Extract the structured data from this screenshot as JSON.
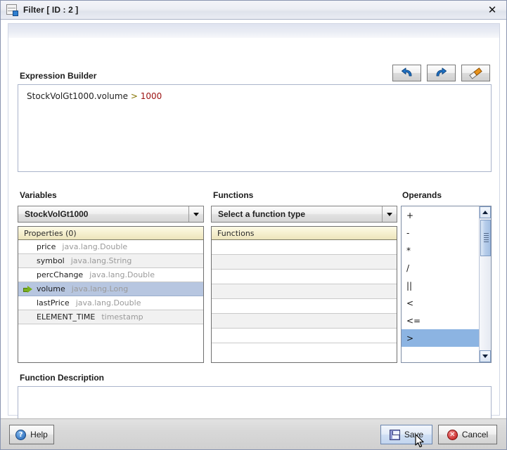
{
  "window": {
    "title": "Filter [ ID : 2 ]",
    "icon": "filter-table-icon",
    "close_label": "✕"
  },
  "expression_builder": {
    "label": "Expression Builder",
    "tools": [
      {
        "name": "undo-button",
        "icon": "undo-icon",
        "title": "Undo"
      },
      {
        "name": "redo-button",
        "icon": "redo-icon",
        "title": "Redo"
      },
      {
        "name": "clear-button",
        "icon": "eraser-icon",
        "title": "Clear"
      }
    ],
    "expression": {
      "operand": "StockVolGt1000.volume",
      "operator": ">",
      "value": "1000"
    }
  },
  "variables": {
    "label": "Variables",
    "selected": "StockVolGt1000",
    "table_header": "Properties (0)",
    "rows": [
      {
        "name": "price",
        "type": "java.lang.Double",
        "selected": false
      },
      {
        "name": "symbol",
        "type": "java.lang.String",
        "selected": false
      },
      {
        "name": "percChange",
        "type": "java.lang.Double",
        "selected": false
      },
      {
        "name": "volume",
        "type": "java.lang.Long",
        "selected": true
      },
      {
        "name": "lastPrice",
        "type": "java.lang.Double",
        "selected": false
      },
      {
        "name": "ELEMENT_TIME",
        "type": "timestamp",
        "selected": false
      }
    ]
  },
  "functions": {
    "label": "Functions",
    "selected": "Select a function type",
    "table_header": "Functions",
    "rows": [
      "",
      "",
      "",
      "",
      "",
      ""
    ]
  },
  "operands": {
    "label": "Operands",
    "items": [
      {
        "symbol": "+",
        "selected": false
      },
      {
        "symbol": "-",
        "selected": false
      },
      {
        "symbol": "*",
        "selected": false
      },
      {
        "symbol": "/",
        "selected": false
      },
      {
        "symbol": "||",
        "selected": false
      },
      {
        "symbol": "<",
        "selected": false
      },
      {
        "symbol": "<=",
        "selected": false
      },
      {
        "symbol": ">",
        "selected": true
      }
    ]
  },
  "function_description": {
    "label": "Function Description",
    "text": ""
  },
  "footer": {
    "help_label": "Help",
    "save_label": "Save",
    "cancel_label": "Cancel",
    "help_icon": "?",
    "cancel_icon": "✕"
  },
  "colors": {
    "selection": "#8cb4e2",
    "row_selection": "#b7c6e0",
    "operator_token": "#857400",
    "number_token": "#9b1010",
    "table_header": "#f6f0d0"
  }
}
